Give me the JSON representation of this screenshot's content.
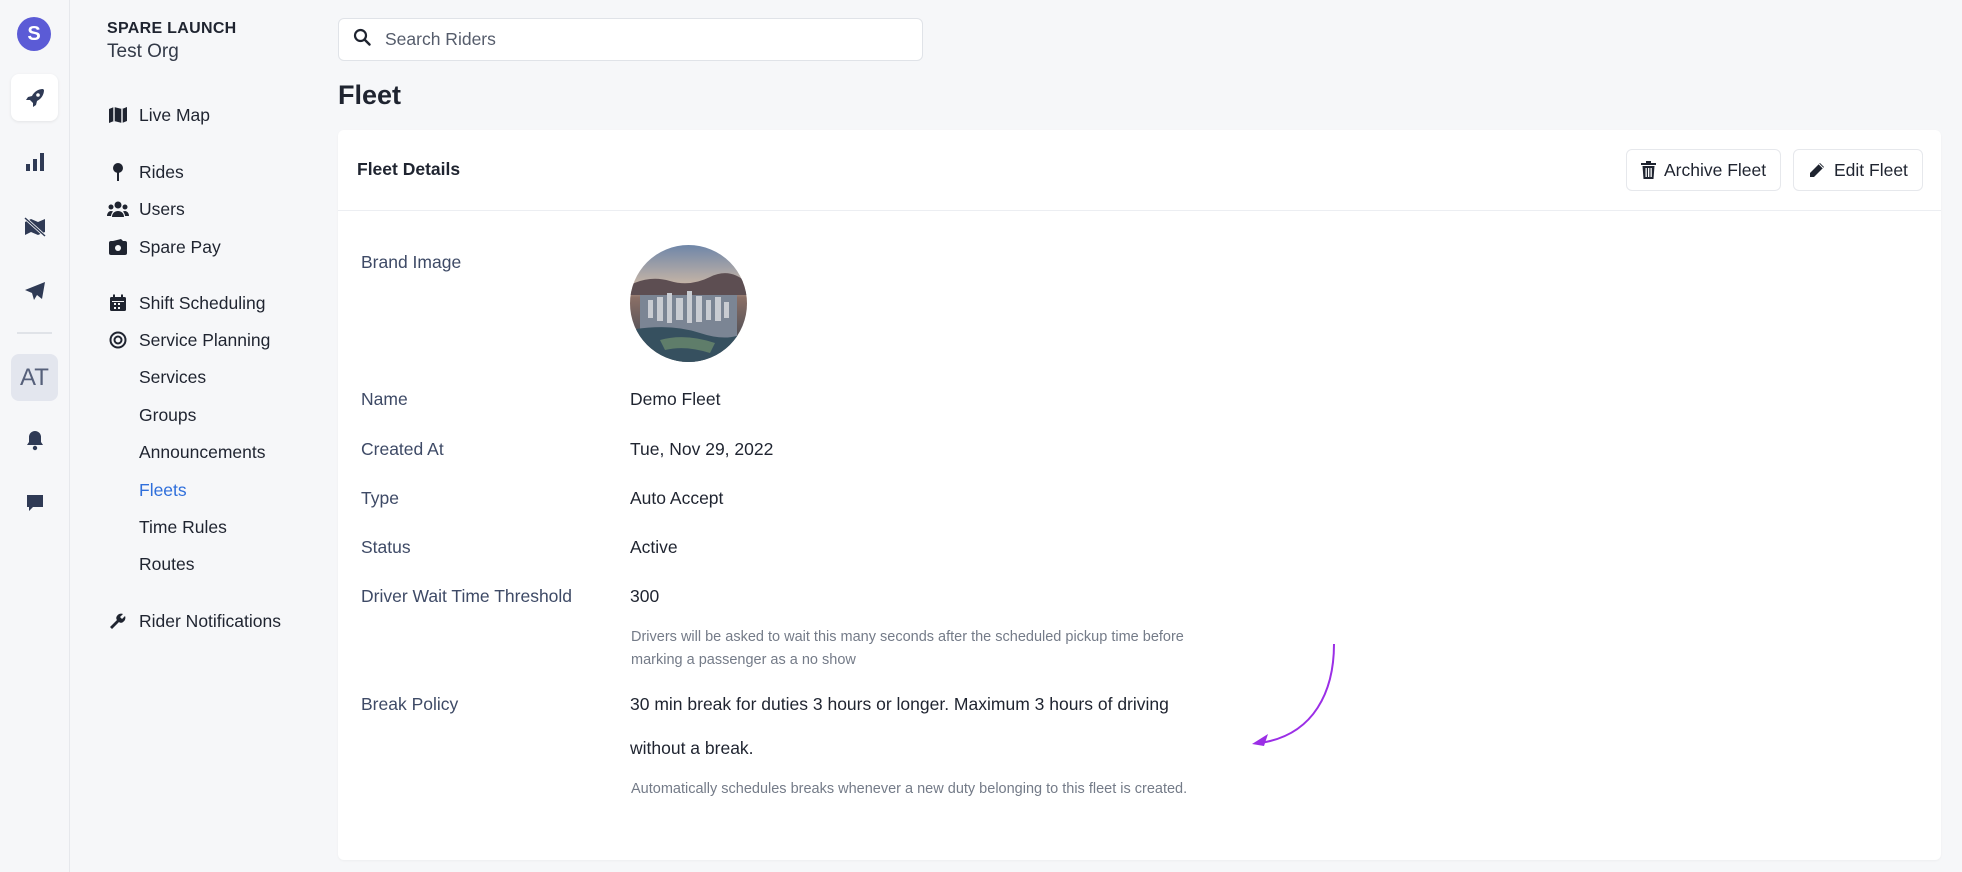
{
  "rail": {
    "avatar_letter": "S",
    "at_label": "AT",
    "icons": [
      "rocket-icon",
      "bar-chart-icon",
      "map-off-icon",
      "paper-plane-icon",
      "bell-icon",
      "chat-icon"
    ]
  },
  "org": {
    "brand": "SPARE LAUNCH",
    "name": "Test Org"
  },
  "nav": {
    "live_map": "Live Map",
    "rides": "Rides",
    "users": "Users",
    "spare_pay": "Spare Pay",
    "shift_scheduling": "Shift Scheduling",
    "service_planning": "Service Planning",
    "services": "Services",
    "groups": "Groups",
    "announcements": "Announcements",
    "fleets": "Fleets",
    "time_rules": "Time Rules",
    "routes": "Routes",
    "rider_notifications": "Rider Notifications"
  },
  "search": {
    "placeholder": "Search Riders"
  },
  "page": {
    "title": "Fleet"
  },
  "card": {
    "title": "Fleet Details",
    "archive_label": "Archive Fleet",
    "edit_label": "Edit Fleet"
  },
  "details": {
    "brand_image_label": "Brand Image",
    "name_label": "Name",
    "name_value": "Demo Fleet",
    "created_label": "Created At",
    "created_value": "Tue, Nov 29, 2022",
    "type_label": "Type",
    "type_value": "Auto Accept",
    "status_label": "Status",
    "status_value": "Active",
    "wait_label": "Driver Wait Time Threshold",
    "wait_value": "300",
    "wait_help": "Drivers will be asked to wait this many seconds after the scheduled pickup time before marking a passenger as a no show",
    "break_label": "Break Policy",
    "break_value_line1": "30 min break for duties 3 hours or longer. Maximum 3 hours of driving",
    "break_value_line2": "without a break.",
    "break_help": "Automatically schedules breaks whenever a new duty belonging to this fleet is created."
  },
  "colors": {
    "accent": "#2f6fdb",
    "avatar": "#5b5bd6",
    "annotation_arrow": "#9b2ee6"
  }
}
